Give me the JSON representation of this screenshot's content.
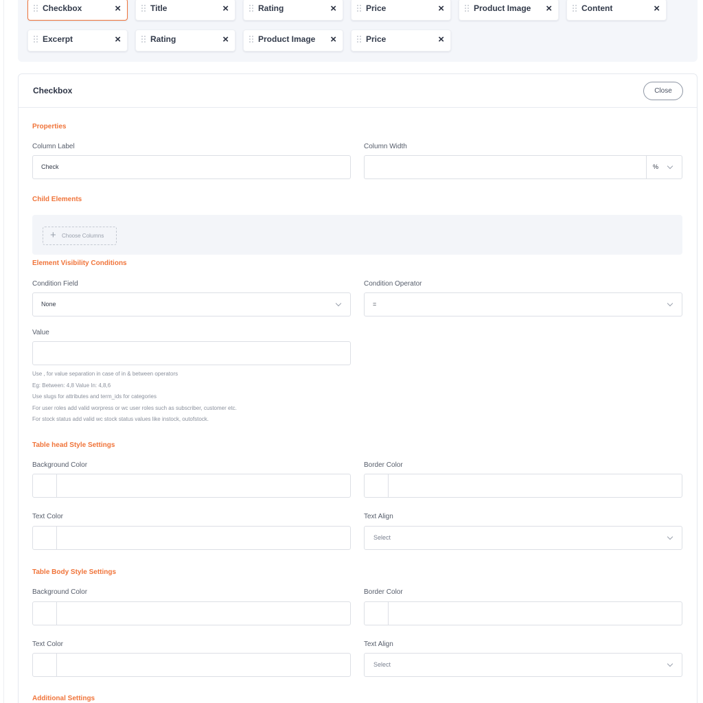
{
  "chips": [
    {
      "label": "Checkbox",
      "active": true
    },
    {
      "label": "Title"
    },
    {
      "label": "Rating"
    },
    {
      "label": "Price"
    },
    {
      "label": "Product Image"
    },
    {
      "label": "Content"
    },
    {
      "label": "Excerpt"
    },
    {
      "label": "Rating"
    },
    {
      "label": "Product Image"
    },
    {
      "label": "Price"
    }
  ],
  "chip_close_glyph": "×",
  "panel": {
    "title": "Checkbox",
    "close_label": "Close"
  },
  "properties": {
    "heading": "Properties",
    "column_label": {
      "label": "Column Label",
      "value": "Check"
    },
    "column_width": {
      "label": "Column Width",
      "value": "",
      "unit": "%"
    }
  },
  "child_elements": {
    "heading": "Child Elements",
    "choose_label": "Choose Columns",
    "plus_glyph": "+"
  },
  "visibility": {
    "heading": "Element Visibility Conditions",
    "condition_field": {
      "label": "Condition Field",
      "value": "None"
    },
    "condition_operator": {
      "label": "Condition Operator",
      "value": "="
    },
    "value_field": {
      "label": "Value",
      "value": ""
    },
    "help": [
      "Use , for value separation in case of in & between operators",
      "Eg: Between: 4,8 Value In: 4,8,6",
      "Use slugs for attributes and term_ids for categories",
      "For user roles add valid worpress or wc user roles such as subscriber, customer etc.",
      "For stock status add valid wc stock status values like instock, outofstock."
    ]
  },
  "head_style": {
    "heading": "Table head Style Settings",
    "background_color": "Background Color",
    "border_color": "Border Color",
    "text_color": "Text Color",
    "text_align": {
      "label": "Text Align",
      "placeholder": "Select"
    }
  },
  "body_style": {
    "heading": "Table Body Style Settings",
    "background_color": "Background Color",
    "border_color": "Border Color",
    "text_color": "Text Color",
    "text_align": {
      "label": "Text Align",
      "placeholder": "Select"
    }
  },
  "additional": {
    "heading": "Additional Settings"
  },
  "colors": {
    "accent": "#f0743a",
    "chip_area_bg": "#f4f6fa",
    "child_box_bg": "#f3f5f9"
  }
}
